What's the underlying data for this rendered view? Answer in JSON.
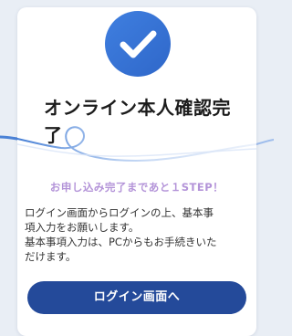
{
  "card": {
    "title": "オンライン本人確認完了",
    "step_notice": "お申し込み完了まであと１STEP！",
    "description_lines": [
      "ログイン画面からログインの上、基本事",
      "項入力をお願いします。",
      "基本事項入力は、PCからもお手続きいた",
      "だけます。"
    ],
    "login_button_label": "ログイン画面へ",
    "icon": "check-icon"
  },
  "colors": {
    "check_circle": "#3a76d8",
    "title_text": "#1c1c1c",
    "step_notice_text": "#b393d8",
    "body_text": "#333333",
    "button_background": "#244a9a",
    "button_text": "#ffffff",
    "wave_line": "#2f6fd0"
  }
}
